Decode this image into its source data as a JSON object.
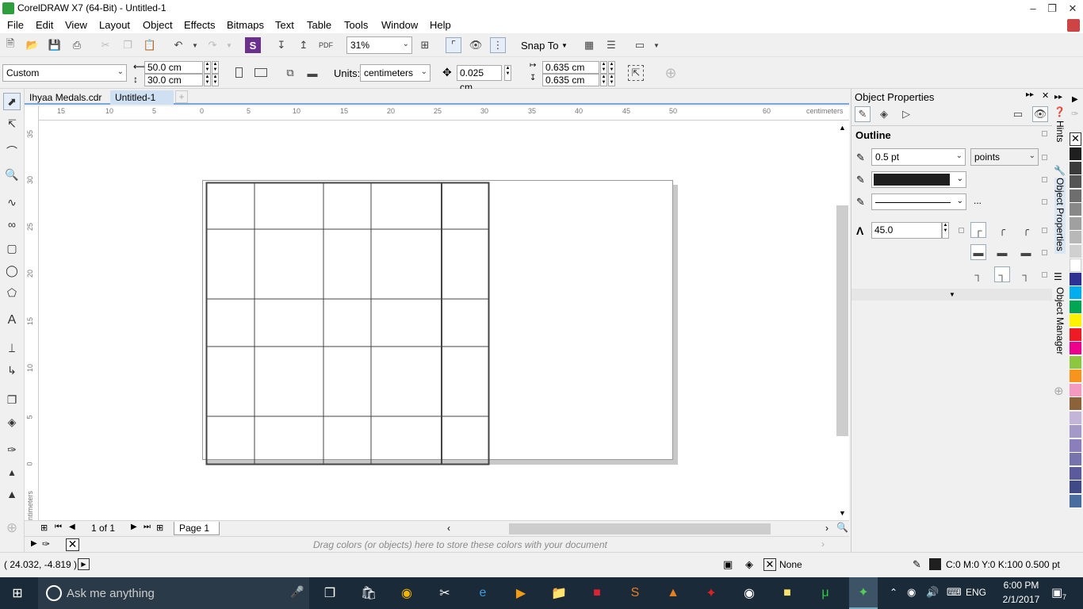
{
  "window": {
    "title": "CorelDRAW X7 (64-Bit) - Untitled-1"
  },
  "menu": [
    "File",
    "Edit",
    "View",
    "Layout",
    "Object",
    "Effects",
    "Bitmaps",
    "Text",
    "Table",
    "Tools",
    "Window",
    "Help"
  ],
  "standard_toolbar": {
    "zoom": "31%",
    "snap_to": "Snap To"
  },
  "property_bar": {
    "page_preset": "Custom",
    "width": "50.0 cm",
    "height": "30.0 cm",
    "units_label": "Units:",
    "units": "centimeters",
    "nudge": "0.025 cm",
    "dup_x": "0.635 cm",
    "dup_y": "0.635 cm"
  },
  "document_tabs": [
    {
      "label": "Ihyaa Medals.cdr",
      "active": false
    },
    {
      "label": "Untitled-1",
      "active": true
    }
  ],
  "rulers": {
    "horizontal_ticks": [
      "15",
      "10",
      "5",
      "0",
      "5",
      "10",
      "15",
      "20",
      "25",
      "30",
      "35",
      "40",
      "45",
      "50",
      "60"
    ],
    "vertical_ticks": [
      "35",
      "30",
      "25",
      "20",
      "15",
      "10",
      "5",
      "0"
    ],
    "unit": "centimeters"
  },
  "page_nav": {
    "counter": "1 of 1",
    "page_tab": "Page 1"
  },
  "document_palette": {
    "hint": "Drag colors (or objects) here to store these colors with your document"
  },
  "docker": {
    "title": "Object Properties",
    "section": "Outline",
    "width_value": "0.5 pt",
    "width_units": "points",
    "more": "...",
    "miter_limit": "45.0"
  },
  "docker_tabs": [
    "Hints",
    "Object Properties",
    "Object Manager"
  ],
  "palette_colors": [
    "#1f1f1f",
    "#3a3a3a",
    "#555555",
    "#6e6e6e",
    "#888888",
    "#a0a0a0",
    "#b8b8b8",
    "#d0d0d0",
    "#ffffff",
    "#2e3192",
    "#00aeef",
    "#00a651",
    "#fff200",
    "#ed1c24",
    "#ec008c",
    "#8dc63f",
    "#f7941d",
    "#f49ac1",
    "#8c6239",
    "#c2b5d8",
    "#a49ac8",
    "#8a7fbb",
    "#7773ad",
    "#5a5a9c",
    "#3f4a86",
    "#4a6da0"
  ],
  "status": {
    "coords": "( 24.032, -4.819 )",
    "fill": "None",
    "outline": "C:0 M:0 Y:0 K:100  0.500 pt"
  },
  "taskbar": {
    "search_placeholder": "Ask me anything",
    "lang": "ENG",
    "time": "6:00 PM",
    "date": "2/1/2017",
    "notifications": "7"
  }
}
